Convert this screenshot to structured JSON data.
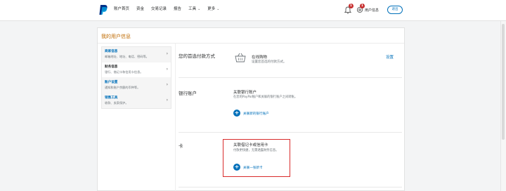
{
  "topbar": {
    "nav": [
      {
        "label": "账户首页"
      },
      {
        "label": "资金"
      },
      {
        "label": "交易记录"
      },
      {
        "label": "报告"
      },
      {
        "label": "工具"
      },
      {
        "label": "更多"
      }
    ],
    "bell_badge": "1",
    "settings_badge": "1",
    "user_label": "用户信息",
    "logout_label": "退出"
  },
  "page": {
    "title": "我的用户信息"
  },
  "sidebar": {
    "items": [
      {
        "title": "商家信息",
        "sub": "邮箱地址、地址、电话、密码等。"
      },
      {
        "title": "财务信息",
        "sub": "银行、借记卡和信用卡信息。"
      },
      {
        "title": "账户设置",
        "sub": "通知和账户余额的币种等。"
      },
      {
        "title": "销售工具",
        "sub": "收款、卖家保护。"
      }
    ]
  },
  "sections": {
    "preferred": {
      "title": "您的首选付款方式",
      "label": "在线购物",
      "desc": "设置您首选的付款方式。",
      "link": "设置"
    },
    "bank": {
      "title": "银行账户",
      "item_title": "关联银行账户",
      "item_desc": "在您的PayPal账户和关联的银行账户之间转账。",
      "add_label": "关联新的银行账户"
    },
    "card": {
      "title": "卡",
      "item_title": "关联借记卡或信用卡",
      "item_desc": "付款更快捷，无需透露财务信息。",
      "add_label": "关联一张新卡"
    }
  },
  "colors": {
    "brand_blue": "#0070ba",
    "title_orange": "#bf6a00",
    "badge_red": "#c72e2e",
    "highlight_red": "#d92b2b"
  }
}
